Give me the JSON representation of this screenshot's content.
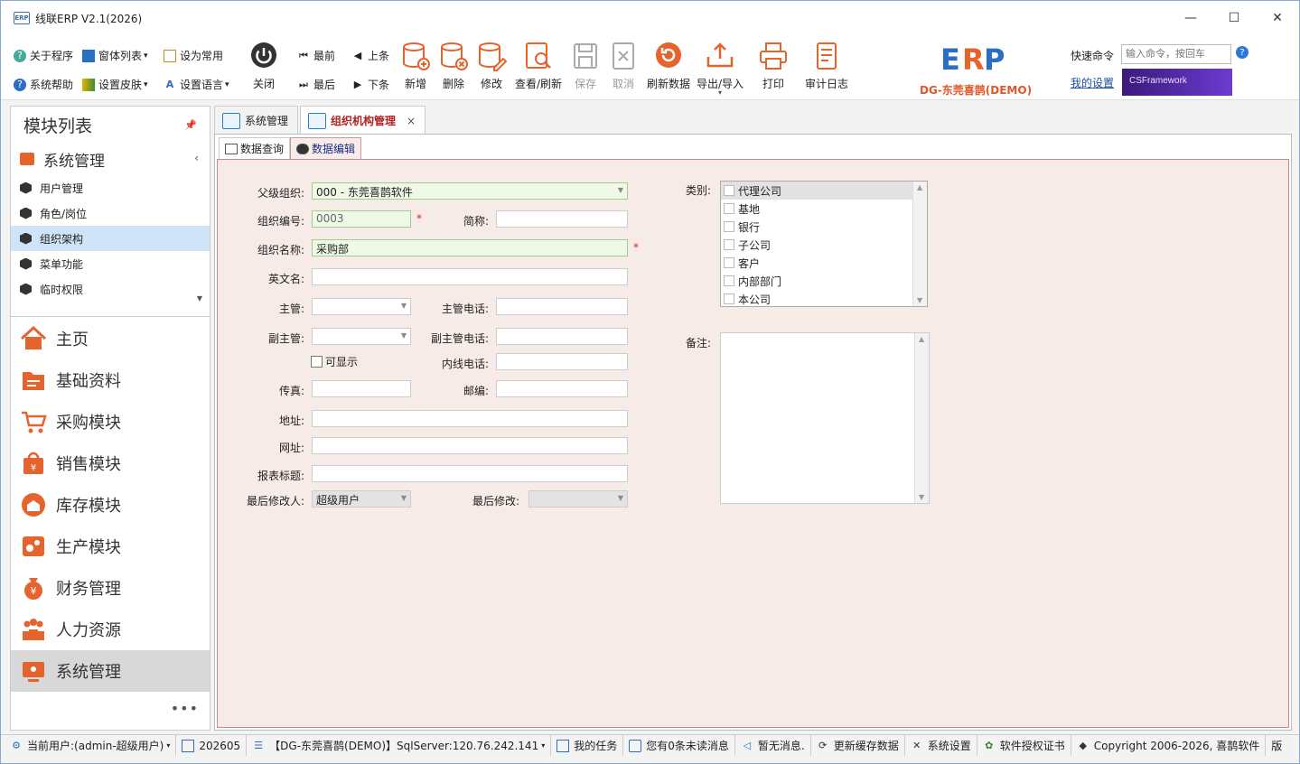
{
  "window": {
    "title": "线联ERP V2.1(2026)",
    "app_icon_text": "ERP",
    "minimize": "—",
    "maximize": "☐",
    "close": "✕"
  },
  "toolbar": {
    "small_items": {
      "about": "关于程序",
      "window_list": "窗体列表",
      "set_common": "设为常用",
      "help": "系统帮助",
      "skin": "设置皮肤",
      "language": "设置语言"
    },
    "buttons": {
      "close": "关闭",
      "first": "最前",
      "prev": "上条",
      "last": "最后",
      "next": "下条",
      "add": "新增",
      "delete": "删除",
      "edit": "修改",
      "view_refresh": "查看/刷新",
      "save": "保存",
      "cancel": "取消",
      "refresh_data": "刷新数据",
      "export_import": "导出/导入",
      "print": "打印",
      "audit_log": "审计日志"
    },
    "brand_sub": "DG-东莞喜鹊(DEMO)",
    "quick_command_label": "快速命令",
    "quick_command_placeholder": "输入命令，按回车",
    "help_mark": "?",
    "my_settings": "我的设置",
    "banner_text": "CSFramework"
  },
  "sidebar": {
    "title": "模块列表",
    "group": "系统管理",
    "items": [
      {
        "label": "用户管理"
      },
      {
        "label": "角色/岗位"
      },
      {
        "label": "组织架构"
      },
      {
        "label": "菜单功能"
      },
      {
        "label": "临时权限"
      }
    ],
    "modules": [
      {
        "label": "主页"
      },
      {
        "label": "基础资料"
      },
      {
        "label": "采购模块"
      },
      {
        "label": "销售模块"
      },
      {
        "label": "库存模块"
      },
      {
        "label": "生产模块"
      },
      {
        "label": "财务管理"
      },
      {
        "label": "人力资源"
      },
      {
        "label": "系统管理"
      }
    ],
    "more": "•••"
  },
  "tabs": {
    "system_mgmt": "系统管理",
    "org_mgmt": "组织机构管理",
    "close": "×"
  },
  "subtabs": {
    "query": "数据查询",
    "edit": "数据编辑"
  },
  "form": {
    "parent_org_label": "父级组织:",
    "parent_org_value": "000 - 东莞喜鹊软件",
    "org_code_label": "组织编号:",
    "org_code_value": "0003",
    "short_name_label": "简称:",
    "short_name_value": "",
    "org_name_label": "组织名称:",
    "org_name_value": "采购部",
    "en_name_label": "英文名:",
    "manager_label": "主管:",
    "manager_phone_label": "主管电话:",
    "deputy_label": "副主管:",
    "deputy_phone_label": "副主管电话:",
    "visible_label": "可显示",
    "ext_phone_label": "内线电话:",
    "fax_label": "传真:",
    "zip_label": "邮编:",
    "address_label": "地址:",
    "website_label": "网址:",
    "report_title_label": "报表标题:",
    "last_modifier_label": "最后修改人:",
    "last_modifier_value": "超级用户",
    "last_modified_label": "最后修改:",
    "last_modified_value": "",
    "required_mark": "*",
    "category_label": "类别:",
    "categories": [
      {
        "label": "代理公司"
      },
      {
        "label": "基地"
      },
      {
        "label": "银行"
      },
      {
        "label": "子公司"
      },
      {
        "label": "客户"
      },
      {
        "label": "内部部门"
      },
      {
        "label": "本公司"
      }
    ],
    "remark_label": "备注:"
  },
  "statusbar": {
    "user": "当前用户:(admin-超级用户)",
    "period": "202605",
    "server": "【DG-东莞喜鹊(DEMO)】SqlServer:120.76.242.141",
    "tasks": "我的任务",
    "messages": "您有0条未读消息",
    "notice": "暂无消息.",
    "refresh_cache": "更新缓存数据",
    "sys_settings": "系统设置",
    "license": "软件授权证书",
    "copyright": "Copyright 2006-2026, 喜鹊软件",
    "version": "版"
  },
  "colors": {
    "accent_orange": "#e5642d",
    "form_bg": "#f7ebe8",
    "active_tab_text": "#b22222",
    "link_blue": "#1a4fa0"
  }
}
